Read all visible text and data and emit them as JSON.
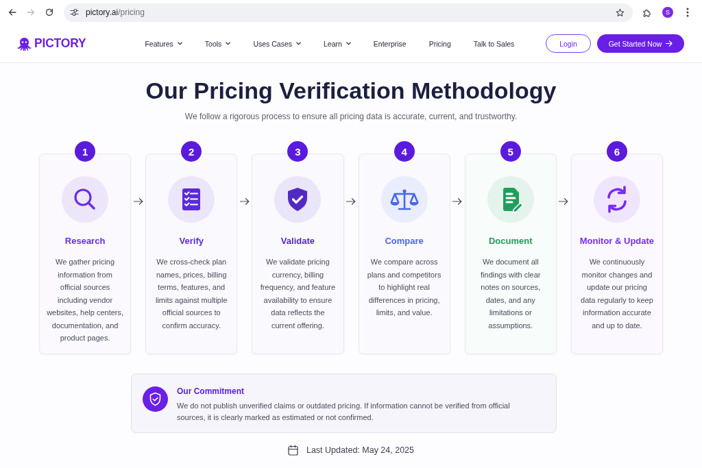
{
  "browser": {
    "forward_disabled": true,
    "address": {
      "host": "pictory.ai",
      "path": "/pricing"
    },
    "profile_initial": "S"
  },
  "nav": {
    "logo": "PICTORY",
    "links": [
      {
        "label": "Features",
        "has_menu": true
      },
      {
        "label": "Tools",
        "has_menu": true
      },
      {
        "label": "Uses Cases",
        "has_menu": true
      },
      {
        "label": "Learn",
        "has_menu": true
      },
      {
        "label": "Enterprise",
        "has_menu": false
      },
      {
        "label": "Pricing",
        "has_menu": false
      },
      {
        "label": "Talk to Sales",
        "has_menu": false
      }
    ],
    "buttons": [
      {
        "label": "Login",
        "kind": "outline"
      },
      {
        "label": "Get Started Now",
        "kind": "primary"
      }
    ]
  },
  "hero": {
    "title": "Our Pricing Verification Methodology",
    "subtitle": "We follow a rigorous process to ensure all pricing data is accurate, current, and trustworthy."
  },
  "steps": [
    {
      "number": "1",
      "title": "Research",
      "text": "We gather pricing information from official sources including vendor websites, help centers, documentation, and product pages.",
      "color": "#6a2fe0"
    },
    {
      "number": "2",
      "title": "Verify",
      "text": "We cross-check plan names, prices, billing terms, features, and limits against multiple official sources to confirm accuracy.",
      "color": "#5b2bd6"
    },
    {
      "number": "3",
      "title": "Validate",
      "text": "We validate pricing currency, billing frequency, and feature availability to ensure data reflects the current offering.",
      "color": "#5329c4"
    },
    {
      "number": "4",
      "title": "Compare",
      "text": "We compare across plans and competitors to highlight real differences in pricing, limits, and value.",
      "color": "#4a66ee"
    },
    {
      "number": "5",
      "title": "Document",
      "text": "We document all findings with clear notes on sources, dates, and any limitations or assumptions.",
      "color": "#1f9e5c"
    },
    {
      "number": "6",
      "title": "Monitor & Update",
      "text": "We continuously monitor changes and update our pricing data regularly to keep information accurate and up to date.",
      "color": "#7a2cf0"
    }
  ],
  "commitment": {
    "title": "Our Commitment",
    "text": "We do not publish unverified claims or outdated pricing. If information cannot be verified from official sources, it is clearly marked as estimated or not confirmed."
  },
  "last_updated": "Last Updated: May 24, 2025"
}
